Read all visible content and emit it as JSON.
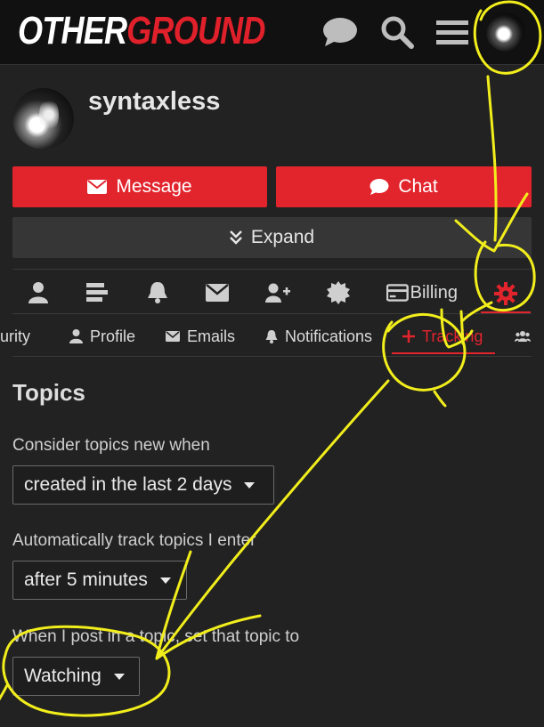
{
  "header": {
    "logo_part1": "OTHER",
    "logo_part2": "GROUND",
    "icons": [
      "chat-bubble-icon",
      "search-icon",
      "hamburger-menu-icon",
      "user-avatar"
    ]
  },
  "profile": {
    "username": "syntaxless",
    "message_label": "Message",
    "chat_label": "Chat",
    "expand_label": "Expand"
  },
  "nav_primary": {
    "icons": [
      "user-icon",
      "list-icon",
      "bell-icon",
      "envelope-icon",
      "user-plus-icon",
      "badge-icon",
      "billing-card-icon",
      "gear-icon"
    ],
    "billing_label": "Billing"
  },
  "nav_secondary": {
    "items": [
      {
        "label": "urity",
        "icon": "",
        "active": false
      },
      {
        "label": "Profile",
        "icon": "user-icon",
        "active": false
      },
      {
        "label": "Emails",
        "icon": "envelope-icon",
        "active": false
      },
      {
        "label": "Notifications",
        "icon": "bell-icon",
        "active": false
      },
      {
        "label": "Tracking",
        "icon": "plus-icon",
        "active": true
      },
      {
        "label": "",
        "icon": "users-icon",
        "active": false
      }
    ]
  },
  "topics": {
    "title": "Topics",
    "consider_new_label": "Consider topics new when",
    "consider_new_value": "created in the last 2 days",
    "auto_track_label": "Automatically track topics I enter",
    "auto_track_value": "after 5 minutes",
    "post_label": "When I post in a topic, set that topic to",
    "post_value": "Watching"
  },
  "colors": {
    "accent": "#e2242d",
    "background": "#222222",
    "header_bg": "#111111",
    "annotation": "#f2ee1c"
  }
}
